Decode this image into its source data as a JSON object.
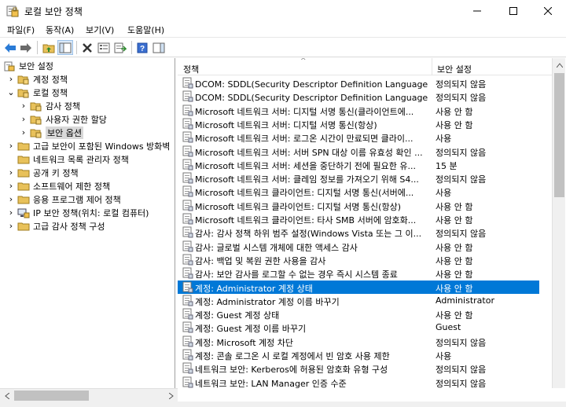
{
  "window": {
    "title": "로컬 보안 정책"
  },
  "menu": [
    "파일(F)",
    "동작(A)",
    "보기(V)",
    "도움말(H)"
  ],
  "tree": [
    {
      "label": "보안 설정",
      "level": 0,
      "expanded": true,
      "icon": "security-root"
    },
    {
      "label": "계정 정책",
      "level": 1,
      "expanded": false,
      "icon": "folder"
    },
    {
      "label": "로컬 정책",
      "level": 1,
      "expanded": true,
      "icon": "folder"
    },
    {
      "label": "감사 정책",
      "level": 2,
      "expanded": false,
      "icon": "folder"
    },
    {
      "label": "사용자 권한 할당",
      "level": 2,
      "expanded": false,
      "icon": "folder"
    },
    {
      "label": "보안 옵션",
      "level": 2,
      "expanded": false,
      "icon": "folder",
      "selected": true
    },
    {
      "label": "고급 보안이 포함된 Windows 방화벽",
      "level": 1,
      "expanded": false,
      "icon": "folder-plain"
    },
    {
      "label": "네트워크 목록 관리자 정책",
      "level": 1,
      "expanded": null,
      "icon": "folder-plain"
    },
    {
      "label": "공개 키 정책",
      "level": 1,
      "expanded": false,
      "icon": "folder-plain"
    },
    {
      "label": "소프트웨어 제한 정책",
      "level": 1,
      "expanded": false,
      "icon": "folder-plain"
    },
    {
      "label": "응용 프로그램 제어 정책",
      "level": 1,
      "expanded": false,
      "icon": "folder-plain"
    },
    {
      "label": "IP 보안 정책(위치: 로컬 컴퓨터)",
      "level": 1,
      "expanded": false,
      "icon": "ipsec"
    },
    {
      "label": "고급 감사 정책 구성",
      "level": 1,
      "expanded": false,
      "icon": "folder-plain"
    }
  ],
  "columns": {
    "policy": "정책",
    "setting": "보안 설정"
  },
  "rows": [
    {
      "policy": "DCOM: SDDL(Security Descriptor Definition Language) 구...",
      "setting": "정의되지 않음"
    },
    {
      "policy": "DCOM: SDDL(Security Descriptor Definition Language) 구...",
      "setting": "정의되지 않음"
    },
    {
      "policy": "Microsoft 네트워크 서버: 디지털 서명 통신(클라이언트에...",
      "setting": "사용 안 함"
    },
    {
      "policy": "Microsoft 네트워크 서버: 디지털 서명 통신(항상)",
      "setting": "사용 안 함"
    },
    {
      "policy": "Microsoft 네트워크 서버: 로그온 시간이 만료되면 클라이...",
      "setting": "사용"
    },
    {
      "policy": "Microsoft 네트워크 서버: 서버 SPN 대상 이름 유효성 확인 ...",
      "setting": "정의되지 않음"
    },
    {
      "policy": "Microsoft 네트워크 서버: 세션을 중단하기 전에 필요한 유...",
      "setting": "15 분"
    },
    {
      "policy": "Microsoft 네트워크 서버: 클레임 정보를 가져오기 위해 S4...",
      "setting": "정의되지 않음"
    },
    {
      "policy": "Microsoft 네트워크 클라이언트: 디지털 서명 통신(서버에...",
      "setting": "사용"
    },
    {
      "policy": "Microsoft 네트워크 클라이언트: 디지털 서명 통신(항상)",
      "setting": "사용 안 함"
    },
    {
      "policy": "Microsoft 네트워크 클라이언트: 타사 SMB 서버에 암호화...",
      "setting": "사용 안 함"
    },
    {
      "policy": "감사: 감사 정책 하위 범주 설정(Windows Vista 또는 그 이...",
      "setting": "정의되지 않음"
    },
    {
      "policy": "감사: 글로벌 시스템 개체에 대한 액세스 감사",
      "setting": "사용 안 함"
    },
    {
      "policy": "감사: 백업 및 복원 권한 사용을 감사",
      "setting": "사용 안 함"
    },
    {
      "policy": "감사: 보안 감사를 로그할 수 없는 경우 즉시 시스템 종료",
      "setting": "사용 안 함"
    },
    {
      "policy": "계정: Administrator 계정 상태",
      "setting": "사용 안 함",
      "selected": true
    },
    {
      "policy": "계정: Administrator 계정 이름 바꾸기",
      "setting": "Administrator"
    },
    {
      "policy": "계정: Guest 계정 상태",
      "setting": "사용 안 함"
    },
    {
      "policy": "계정: Guest 계정 이름 바꾸기",
      "setting": "Guest"
    },
    {
      "policy": "계정: Microsoft 계정 차단",
      "setting": "정의되지 않음"
    },
    {
      "policy": "계정: 콘솔 로그온 시 로컬 계정에서 빈 암호 사용 제한",
      "setting": "사용"
    },
    {
      "policy": "네트워크 보안: Kerberos에 허용된 암호화 유형 구성",
      "setting": "정의되지 않음"
    },
    {
      "policy": "네트워크 보안: LAN Manager 인증 수준",
      "setting": "정의되지 않음"
    }
  ],
  "colors": {
    "selection": "#0078d7",
    "tree_selection": "#d9d9d9",
    "scroll_thumb": "#c1c1c1"
  }
}
